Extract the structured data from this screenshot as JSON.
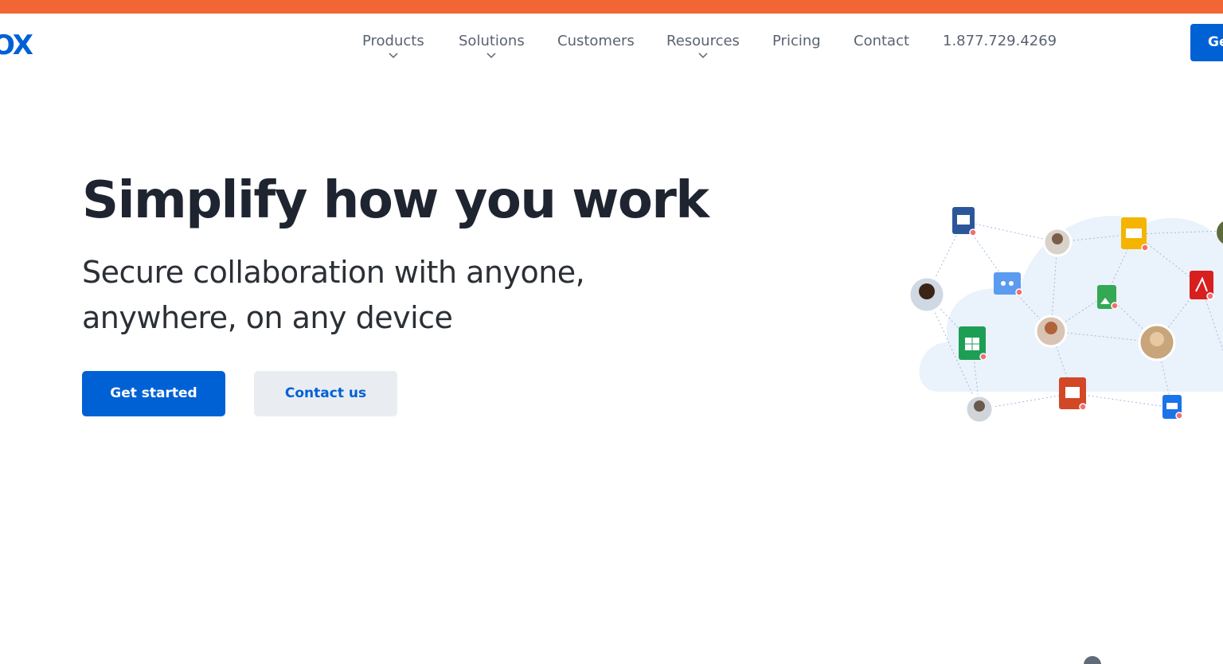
{
  "brand": {
    "logo_text": "OX",
    "banner_color": "#f26635",
    "accent_color": "#0061d5"
  },
  "nav": {
    "items": [
      {
        "label": "Products",
        "has_dropdown": true
      },
      {
        "label": "Solutions",
        "has_dropdown": true
      },
      {
        "label": "Customers",
        "has_dropdown": false
      },
      {
        "label": "Resources",
        "has_dropdown": true
      },
      {
        "label": "Pricing",
        "has_dropdown": false
      },
      {
        "label": "Contact",
        "has_dropdown": false
      }
    ],
    "phone": "1.877.729.4269",
    "cta_label": "Ge"
  },
  "hero": {
    "title": "Simplify how you work",
    "subtitle_line1": "Secure collaboration with anyone,",
    "subtitle_line2": "anywhere, on any device",
    "primary_button": "Get started",
    "secondary_button": "Contact us"
  },
  "illustration": {
    "icons": [
      "word-doc-icon",
      "slides-icon",
      "pdf-icon",
      "shared-folder-icon",
      "image-file-icon",
      "sheets-icon",
      "powerpoint-icon",
      "doc-file-icon"
    ],
    "avatars": [
      "user-avatar-1",
      "user-avatar-2",
      "user-avatar-3",
      "user-avatar-4",
      "user-avatar-5"
    ]
  }
}
